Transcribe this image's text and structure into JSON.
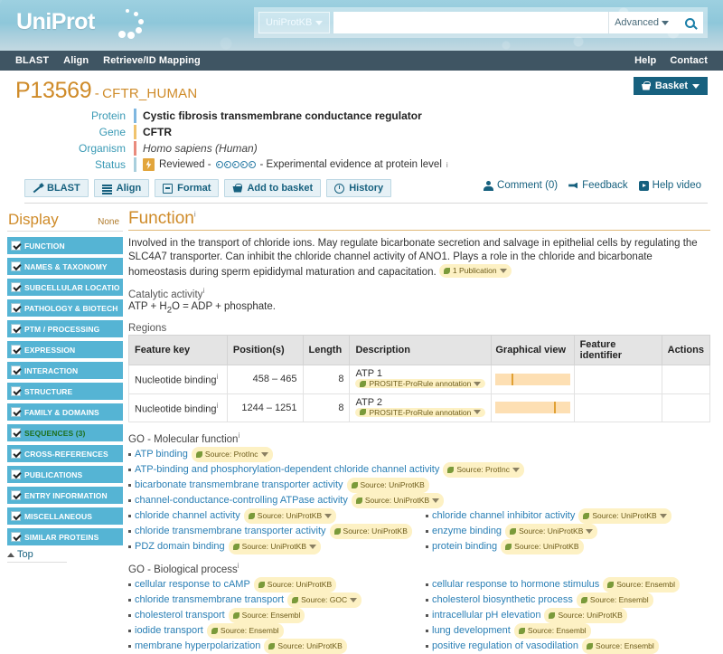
{
  "header": {
    "logo_text": "UniProt",
    "search": {
      "scope": "UniProtKB",
      "value": "",
      "placeholder": "",
      "advanced_label": "Advanced"
    }
  },
  "nav": {
    "left": [
      "BLAST",
      "Align",
      "Retrieve/ID Mapping"
    ],
    "right": [
      "Help",
      "Contact"
    ]
  },
  "entry": {
    "accession": "P13569",
    "separator": "-",
    "entry_name": "CFTR_HUMAN",
    "basket_label": "Basket",
    "fields": [
      {
        "label": "Protein",
        "value": "Cystic fibrosis transmembrane conductance regulator"
      },
      {
        "label": "Gene",
        "value": "CFTR"
      },
      {
        "label": "Organism",
        "value": "Homo sapiens (Human)"
      }
    ],
    "status_label": "Status",
    "status_text": "Reviewed -",
    "status_dots": 5,
    "status_evidence": "- Experimental evidence at protein level",
    "sup": "i"
  },
  "toolbar": {
    "buttons": [
      {
        "label": "BLAST",
        "icon": "blast-icon"
      },
      {
        "label": "Align",
        "icon": "align-icon"
      },
      {
        "label": "Format",
        "icon": "format-icon"
      },
      {
        "label": "Add to basket",
        "icon": "basket-icon"
      },
      {
        "label": "History",
        "icon": "history-icon"
      }
    ],
    "meta": [
      {
        "label": "Comment (0)",
        "icon": "comment-icon"
      },
      {
        "label": "Feedback",
        "icon": "feedback-icon"
      },
      {
        "label": "Help video",
        "icon": "video-icon"
      }
    ]
  },
  "sidebar": {
    "title": "Display",
    "none_label": "None",
    "top_label": "Top",
    "items": [
      {
        "label": "FUNCTION",
        "checked": true,
        "active": false
      },
      {
        "label": "NAMES & TAXONOMY",
        "checked": true,
        "active": false
      },
      {
        "label": "SUBCELLULAR LOCATION",
        "checked": true,
        "active": false
      },
      {
        "label": "PATHOLOGY & BIOTECH",
        "checked": true,
        "active": false
      },
      {
        "label": "PTM / PROCESSING",
        "checked": true,
        "active": false
      },
      {
        "label": "EXPRESSION",
        "checked": true,
        "active": false
      },
      {
        "label": "INTERACTION",
        "checked": true,
        "active": false
      },
      {
        "label": "STRUCTURE",
        "checked": true,
        "active": false
      },
      {
        "label": "FAMILY & DOMAINS",
        "checked": true,
        "active": false
      },
      {
        "label": "SEQUENCES (3)",
        "checked": true,
        "active": true
      },
      {
        "label": "CROSS-REFERENCES",
        "checked": true,
        "active": false
      },
      {
        "label": "PUBLICATIONS",
        "checked": true,
        "active": false
      },
      {
        "label": "ENTRY INFORMATION",
        "checked": true,
        "active": false
      },
      {
        "label": "MISCELLANEOUS",
        "checked": true,
        "active": false
      },
      {
        "label": "SIMILAR PROTEINS",
        "checked": true,
        "active": false
      }
    ]
  },
  "function": {
    "heading": "Function",
    "description": "Involved in the transport of chloride ions. May regulate bicarbonate secretion and salvage in epithelial cells by regulating the SLC4A7 transporter. Can inhibit the chloride channel activity of ANO1. Plays a role in the chloride and bicarbonate homeostasis during sperm epididymal maturation and capacitation.",
    "description_evidence": "1 Publication",
    "catalytic_heading": "Catalytic activity",
    "catalytic_value": "ATP + H2O = ADP + phosphate.",
    "regions_heading": "Regions"
  },
  "regions_table": {
    "headers": [
      "Feature key",
      "Position(s)",
      "Length",
      "Description",
      "Graphical view",
      "Feature identifier",
      "Actions"
    ],
    "rows": [
      {
        "feature_key": "Nucleotide binding",
        "positions": "458 – 465",
        "length": "8",
        "description": "ATP 1",
        "evidence": "PROSITE-ProRule annotation",
        "gv_mark_pct": 22,
        "feature_identifier": "",
        "actions": ""
      },
      {
        "feature_key": "Nucleotide binding",
        "positions": "1244 – 1251",
        "length": "8",
        "description": "ATP 2",
        "evidence": "PROSITE-ProRule annotation",
        "gv_mark_pct": 79,
        "feature_identifier": "",
        "actions": ""
      }
    ]
  },
  "go_molecular": {
    "heading": "GO - Molecular function",
    "left": [
      {
        "term": "ATP binding",
        "source": "Source: ProtInc",
        "caret": true
      },
      {
        "term": "ATP-binding and phosphorylation-dependent chloride channel activity",
        "source": "Source: ProtInc",
        "caret": true
      },
      {
        "term": "bicarbonate transmembrane transporter activity",
        "source": "Source: UniProtKB",
        "caret": false
      },
      {
        "term": "channel-conductance-controlling ATPase activity",
        "source": "Source: UniProtKB",
        "caret": true
      },
      {
        "term": "chloride channel activity",
        "source": "Source: UniProtKB",
        "caret": true
      },
      {
        "term": "chloride transmembrane transporter activity",
        "source": "Source: UniProtKB",
        "caret": false
      },
      {
        "term": "PDZ domain binding",
        "source": "Source: UniProtKB",
        "caret": true
      }
    ],
    "right": [
      {
        "term": "chloride channel inhibitor activity",
        "source": "Source: UniProtKB",
        "caret": true
      },
      {
        "term": "enzyme binding",
        "source": "Source: UniProtKB",
        "caret": true
      },
      {
        "term": "protein binding",
        "source": "Source: UniProtKB",
        "caret": false
      }
    ]
  },
  "go_biological": {
    "heading": "GO - Biological process",
    "left": [
      {
        "term": "cellular response to cAMP",
        "source": "Source: UniProtKB",
        "caret": false
      },
      {
        "term": "chloride transmembrane transport",
        "source": "Source: GOC",
        "caret": true
      },
      {
        "term": "cholesterol transport",
        "source": "Source: Ensembl",
        "caret": false
      },
      {
        "term": "iodide transport",
        "source": "Source: Ensembl",
        "caret": false
      },
      {
        "term": "membrane hyperpolarization",
        "source": "Source: UniProtKB",
        "caret": false
      }
    ],
    "right": [
      {
        "term": "cellular response to hormone stimulus",
        "source": "Source: Ensembl",
        "caret": false
      },
      {
        "term": "cholesterol biosynthetic process",
        "source": "Source: Ensembl",
        "caret": false
      },
      {
        "term": "intracellular pH elevation",
        "source": "Source: UniProtKB",
        "caret": false
      },
      {
        "term": "lung development",
        "source": "Source: Ensembl",
        "caret": false
      },
      {
        "term": "positive regulation of vasodilation",
        "source": "Source: Ensembl",
        "caret": false
      }
    ]
  },
  "colors": {
    "brand_header": "#8ec7da",
    "nav_bar": "#3f5563",
    "accent_orange": "#cf8b29",
    "link_blue": "#2a7fb5",
    "sidebar_item": "#55b4d4",
    "evidence_yellow": "#fdf1c4",
    "graphical_track": "#fddfb3",
    "graphical_mark": "#e0a033"
  }
}
